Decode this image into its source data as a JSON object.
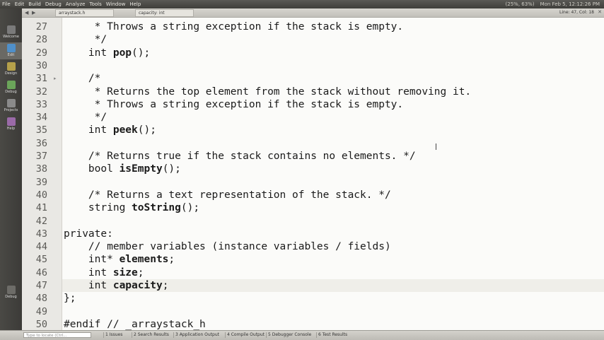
{
  "menu": {
    "items": [
      "File",
      "Edit",
      "Build",
      "Debug",
      "Analyze",
      "Tools",
      "Window",
      "Help"
    ],
    "status_right": [
      "(25%, 63%)",
      "Mon Feb 5, 12:12:26 PM"
    ]
  },
  "sidebar": {
    "items": [
      {
        "label": "Welcome"
      },
      {
        "label": "Edit"
      },
      {
        "label": "Design"
      },
      {
        "label": "Debug"
      },
      {
        "label": "Projects"
      },
      {
        "label": "Help"
      }
    ],
    "bottom": [
      {
        "label": "Debug"
      }
    ]
  },
  "tabbar": {
    "file": "arraystack.h",
    "symbol": "capacity: int",
    "position": "Line: 47, Col: 18"
  },
  "lines": [
    {
      "n": "27",
      "parts": [
        {
          "t": "     * Throws a string exception if the stack is empty."
        }
      ]
    },
    {
      "n": "28",
      "parts": [
        {
          "t": "     */"
        }
      ]
    },
    {
      "n": "29",
      "parts": [
        {
          "t": "    int "
        },
        {
          "t": "pop",
          "b": true
        },
        {
          "t": "();"
        }
      ]
    },
    {
      "n": "30",
      "parts": [
        {
          "t": ""
        }
      ]
    },
    {
      "n": "31",
      "fold": true,
      "parts": [
        {
          "t": "    /*"
        }
      ]
    },
    {
      "n": "32",
      "parts": [
        {
          "t": "     * Returns the top element from the stack without removing it."
        }
      ]
    },
    {
      "n": "33",
      "parts": [
        {
          "t": "     * Throws a string exception if the stack is empty."
        }
      ]
    },
    {
      "n": "34",
      "parts": [
        {
          "t": "     */"
        }
      ]
    },
    {
      "n": "35",
      "parts": [
        {
          "t": "    int "
        },
        {
          "t": "peek",
          "b": true
        },
        {
          "t": "();"
        }
      ]
    },
    {
      "n": "36",
      "parts": [
        {
          "t": ""
        }
      ]
    },
    {
      "n": "37",
      "parts": [
        {
          "t": "    /* Returns true if the stack contains no elements. */"
        }
      ]
    },
    {
      "n": "38",
      "parts": [
        {
          "t": "    bool "
        },
        {
          "t": "isEmpty",
          "b": true
        },
        {
          "t": "();"
        }
      ]
    },
    {
      "n": "39",
      "parts": [
        {
          "t": ""
        }
      ]
    },
    {
      "n": "40",
      "parts": [
        {
          "t": "    /* Returns a text representation of the stack. */"
        }
      ]
    },
    {
      "n": "41",
      "parts": [
        {
          "t": "    string "
        },
        {
          "t": "toString",
          "b": true
        },
        {
          "t": "();"
        }
      ]
    },
    {
      "n": "42",
      "parts": [
        {
          "t": ""
        }
      ]
    },
    {
      "n": "43",
      "parts": [
        {
          "t": "private:"
        }
      ]
    },
    {
      "n": "44",
      "parts": [
        {
          "t": "    // member variables (instance variables / fields)"
        }
      ]
    },
    {
      "n": "45",
      "parts": [
        {
          "t": "    int* "
        },
        {
          "t": "elements",
          "b": true
        },
        {
          "t": ";"
        }
      ]
    },
    {
      "n": "46",
      "parts": [
        {
          "t": "    int "
        },
        {
          "t": "size",
          "b": true
        },
        {
          "t": ";"
        }
      ]
    },
    {
      "n": "47",
      "current": true,
      "parts": [
        {
          "t": "    int "
        },
        {
          "t": "capacity",
          "b": true
        },
        {
          "t": ";"
        }
      ]
    },
    {
      "n": "48",
      "parts": [
        {
          "t": "};"
        }
      ]
    },
    {
      "n": "49",
      "parts": [
        {
          "t": ""
        }
      ]
    },
    {
      "n": "50",
      "parts": [
        {
          "t": "#endif // _arraystack_h"
        }
      ]
    }
  ],
  "bottombar": {
    "locate_placeholder": "Type to locate (Ctrl...",
    "tabs": [
      "1 Issues",
      "2 Search Results",
      "3 Application Output",
      "4 Compile Output",
      "5 Debugger Console",
      "6 Test Results"
    ]
  },
  "colors": {
    "sidebar": "#3c3b38",
    "editor_bg": "#fbfbf9",
    "current_line": "#efeee9",
    "menubar": "#3f3e3a"
  }
}
